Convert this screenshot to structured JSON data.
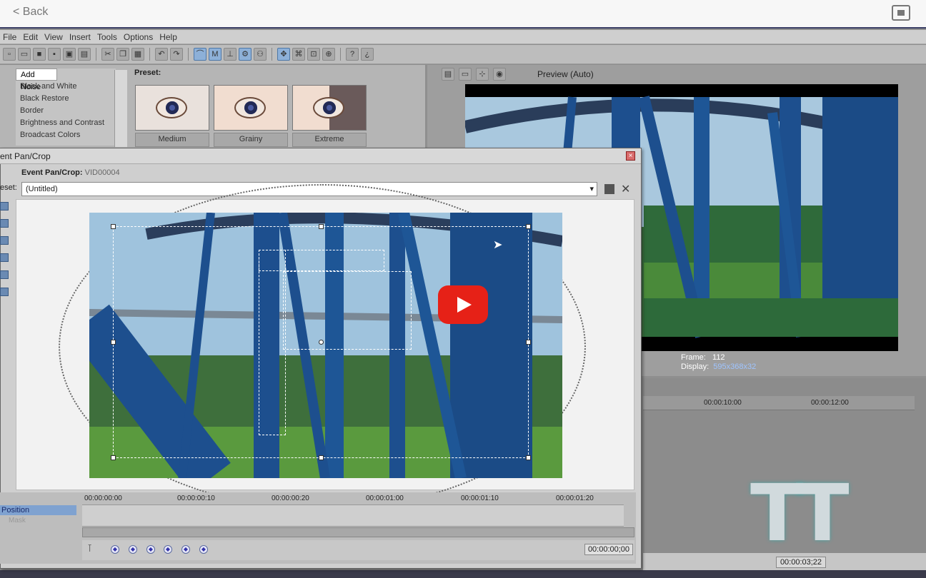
{
  "topbar": {
    "back_label": "< Back"
  },
  "menu": [
    "File",
    "Edit",
    "View",
    "Insert",
    "Tools",
    "Options",
    "Help"
  ],
  "fx": {
    "items": [
      "Add Noise",
      "Black and White",
      "Black Restore",
      "Border",
      "Brightness and Contrast",
      "Broadcast Colors"
    ],
    "preset_label": "Preset:",
    "presets": [
      "Medium",
      "Grainy",
      "Extreme"
    ]
  },
  "preview": {
    "mode": "Preview (Auto)",
    "frame_label": "Frame:",
    "frame_value": "112",
    "display_label": "Display:",
    "display_value": "595x368x32"
  },
  "timeline": {
    "marks": [
      "00:00:10:00",
      "00:00:12:00"
    ],
    "timecode": "00:00:03;22"
  },
  "dialog": {
    "title": "ent Pan/Crop",
    "subtitle_bold": "Event Pan/Crop:",
    "subtitle_value": "VID00004",
    "preset_label": "eset:",
    "preset_value": "(Untitled)",
    "tracks": {
      "position": "Position",
      "mask": "Mask"
    },
    "ruler": [
      "00:00:00:00",
      "00:00:00:10",
      "00:00:00:20",
      "00:00:01:00",
      "00:00:01:10",
      "00:00:01:20"
    ],
    "timecode": "00:00:00;00"
  },
  "watermark": "TT",
  "colors": {
    "accent_blue": "#8db0d8",
    "youtube_red": "#e62117",
    "sky": "#9fc3dd",
    "steel_blue": "#1d4f8e"
  }
}
